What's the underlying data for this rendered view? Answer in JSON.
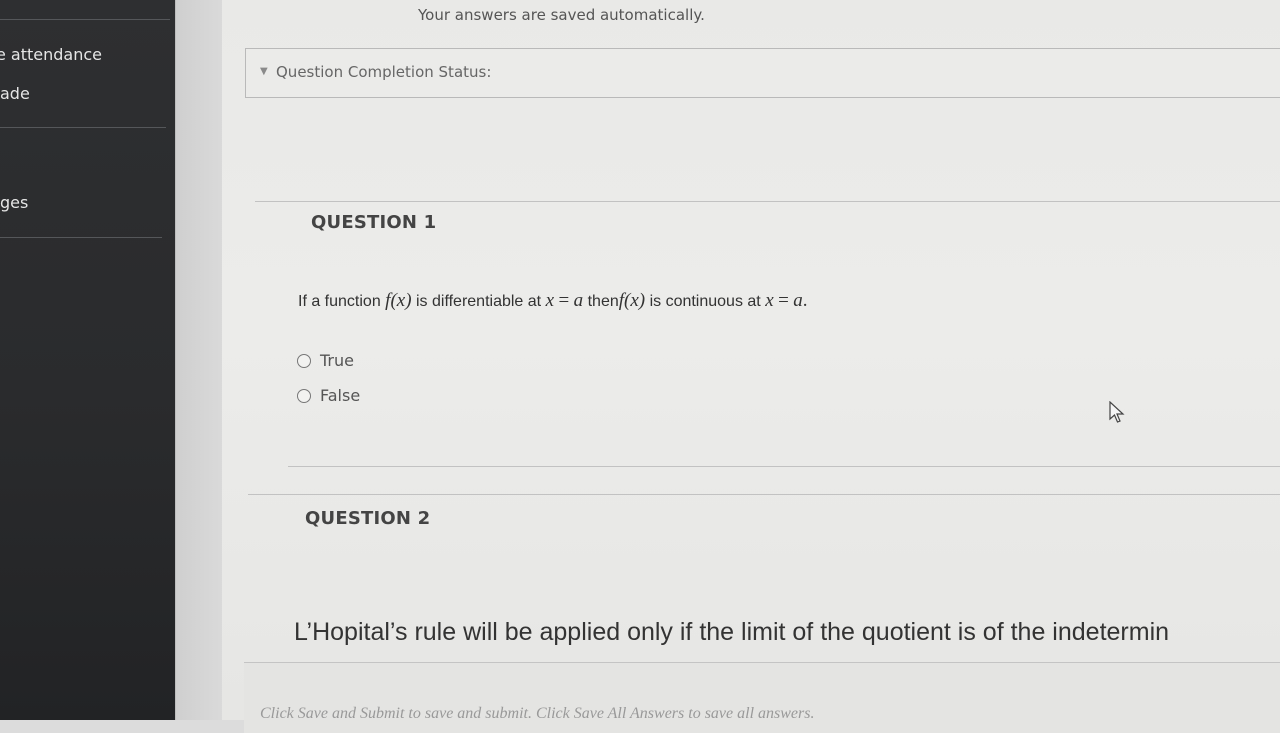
{
  "sidebar": {
    "items": [
      {
        "label": "e attendance"
      },
      {
        "label": "ade"
      },
      {
        "label": "ges"
      }
    ]
  },
  "header": {
    "saved_message": "Your answers are saved automatically."
  },
  "status": {
    "label": "Question Completion Status:",
    "toggle_icon": "chevron-down-icon"
  },
  "questions": [
    {
      "heading": "QUESTION 1",
      "text_parts": {
        "p1": "If a function",
        "p2": "is differentiable at",
        "p3": "then",
        "p4": "is continuous at"
      },
      "math": {
        "fx": "f(x)",
        "x": "x",
        "eq": "=",
        "a": "a",
        "period": "."
      },
      "options": [
        {
          "label": "True",
          "selected": false
        },
        {
          "label": "False",
          "selected": false
        }
      ]
    },
    {
      "heading": "QUESTION 2",
      "text": "L’Hopital’s rule will be applied only if the limit of the quotient is of the indetermin"
    }
  ],
  "footer": {
    "text": "Click Save and Submit to save and submit. Click Save All Answers to save all answers."
  }
}
